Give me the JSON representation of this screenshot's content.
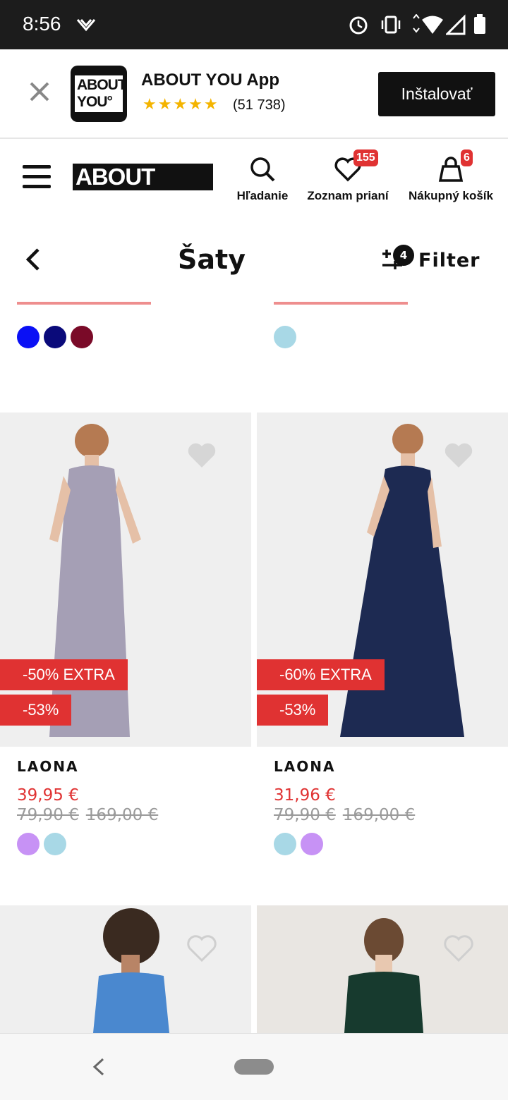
{
  "status_bar": {
    "time": "8:56"
  },
  "banner": {
    "app_name": "ABOUT YOU App",
    "rating_stars": "★★★★★",
    "reviews": "(51 738)",
    "install_label": "Inštalovať",
    "logo_text_1": "ABOUT",
    "logo_text_2": "YOU°"
  },
  "header": {
    "brand": "ABOUT YOU°",
    "search_label": "Hľadanie",
    "wishlist_label": "Zoznam prianí",
    "wishlist_count": "155",
    "cart_label": "Nákupný košík",
    "cart_count": "6"
  },
  "page": {
    "title": "Šaty",
    "filter_label": "Filter",
    "filter_count": "4"
  },
  "previous_row": {
    "left_swatches": [
      "#0a10f5",
      "#0a0a7a",
      "#7a0a28"
    ],
    "right_swatches": [
      "#a8d8e6"
    ]
  },
  "products": [
    {
      "brand": "LAONA",
      "tag_extra": "-50% EXTRA",
      "tag_discount": "-53%",
      "price_now": "39,95 €",
      "price_old_1": "79,90 €",
      "price_old_2": "169,00 €",
      "dress_color": "#a59fb5",
      "swatches": [
        "#c792f5",
        "#a8d8e6"
      ]
    },
    {
      "brand": "LAONA",
      "tag_extra": "-60% EXTRA",
      "tag_discount": "-53%",
      "price_now": "31,96 €",
      "price_old_1": "79,90 €",
      "price_old_2": "169,00 €",
      "dress_color": "#1d2a52",
      "swatches": [
        "#a8d8e6",
        "#c792f5"
      ]
    }
  ],
  "colors": {
    "accent_red": "#e03232",
    "dark": "#111111"
  }
}
